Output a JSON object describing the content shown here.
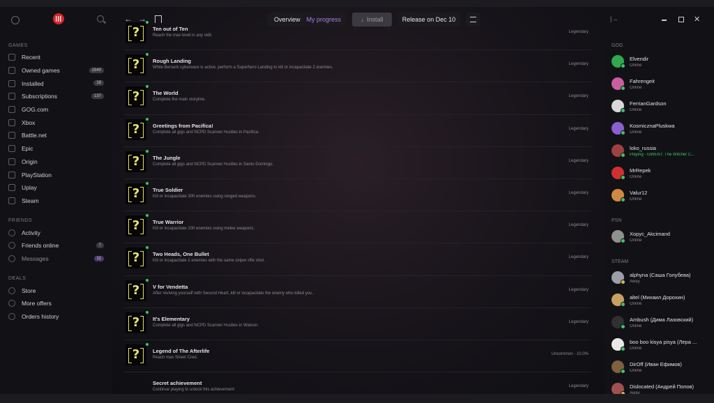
{
  "sidebar": {
    "games_header": "GAMES",
    "games": [
      {
        "label": "Recent",
        "badge": ""
      },
      {
        "label": "Owned games",
        "badge": "1540"
      },
      {
        "label": "Installed",
        "badge": "18"
      },
      {
        "label": "Subscriptions",
        "badge": "137"
      },
      {
        "label": "GOG.com",
        "badge": ""
      },
      {
        "label": "Xbox",
        "badge": ""
      },
      {
        "label": "Battle.net",
        "badge": ""
      },
      {
        "label": "Epic",
        "badge": ""
      },
      {
        "label": "Origin",
        "badge": ""
      },
      {
        "label": "PlayStation",
        "badge": ""
      },
      {
        "label": "Uplay",
        "badge": ""
      },
      {
        "label": "Steam",
        "badge": ""
      }
    ],
    "friends_header": "FRIENDS",
    "friends": [
      {
        "label": "Activity",
        "badge": ""
      },
      {
        "label": "Friends online",
        "badge": "7"
      },
      {
        "label": "Messages",
        "badge": "11"
      }
    ],
    "deals_header": "DEALS",
    "deals": [
      {
        "label": "Store"
      },
      {
        "label": "More offers"
      },
      {
        "label": "Orders history"
      }
    ]
  },
  "toolbar": {
    "tab_overview": "Overview",
    "tab_progress": "My progress",
    "install_label": "Install",
    "release_label": "Release on Dec 10"
  },
  "achievements": [
    {
      "title": "Ten out of Ten",
      "desc": "Reach the max level in any skill.",
      "rarity": "Legendary"
    },
    {
      "title": "Rough Landing",
      "desc": "While Berserk cyberware is active, perform a Superhero Landing to kill or incapacitate 2 enemies.",
      "rarity": "Legendary"
    },
    {
      "title": "The World",
      "desc": "Complete the main storyline.",
      "rarity": "Legendary"
    },
    {
      "title": "Greetings from Pacifica!",
      "desc": "Complete all gigs and NCPD Scanner Hustles in Pacifica.",
      "rarity": "Legendary"
    },
    {
      "title": "The Jungle",
      "desc": "Complete all gigs and NCPD Scanner Hustles in Santo Domingo.",
      "rarity": "Legendary"
    },
    {
      "title": "True Soldier",
      "desc": "Kill or incapacitate 300 enemies using ranged weapons.",
      "rarity": "Legendary"
    },
    {
      "title": "True Warrior",
      "desc": "Kill or incapacitate 100 enemies using melee weapons.",
      "rarity": "Legendary"
    },
    {
      "title": "Two Heads, One Bullet",
      "desc": "Kill or incapacitate 2 enemies with the same sniper rifle shot.",
      "rarity": "Legendary"
    },
    {
      "title": "V for Vendetta",
      "desc": "After reviving yourself with Second Heart, kill or incapacitate the enemy who killed you.",
      "rarity": "Legendary"
    },
    {
      "title": "It's Elementary",
      "desc": "Complete all gigs and NCPD Scanner Hustles in Watson.",
      "rarity": "Legendary"
    },
    {
      "title": "Legend of The Afterlife",
      "desc": "Reach max Street Cred.",
      "rarity": "Uncommon - 10.0%"
    },
    {
      "title": "Secret achievement",
      "desc": "Continue playing to unlock this achievement",
      "rarity": "Legendary"
    }
  ],
  "friends_panel": {
    "gog_header": "GOG",
    "gog": [
      {
        "name": "Elvendir",
        "status": "Online",
        "color": "#2fa84f"
      },
      {
        "name": "Fahrengeit",
        "status": "Online",
        "color": "#c85fa0"
      },
      {
        "name": "FerrianGardson",
        "status": "Online",
        "color": "#d8d8d8"
      },
      {
        "name": "KosmicznaPluskwa",
        "status": "Online",
        "color": "#8a5fd0"
      },
      {
        "name": "loko_russia",
        "status": "Playing - GWENT: The Witcher C...",
        "color": "#a04040"
      },
      {
        "name": "MrRepek",
        "status": "Online",
        "color": "#d03030"
      },
      {
        "name": "Valur12",
        "status": "Online",
        "color": "#d08a40"
      }
    ],
    "psn_header": "PSN",
    "psn": [
      {
        "name": "Xopyc_Akcimand",
        "status": "Online",
        "color": "#909090"
      }
    ],
    "steam_header": "STEAM",
    "steam": [
      {
        "name": "alphyna (Саша Голубева)",
        "status": "Away",
        "color": "#9aa0a8"
      },
      {
        "name": "altel (Михаил Дорохин)",
        "status": "Online",
        "color": "#c8a060"
      },
      {
        "name": "Ambush (Дима Лазовский)",
        "status": "Online",
        "color": "#303030"
      },
      {
        "name": "boo boo kisya pisya (Лера ...",
        "status": "Online",
        "color": "#e8e8e8"
      },
      {
        "name": "DirOff (Иван Ефимов)",
        "status": "Online",
        "color": "#806040"
      },
      {
        "name": "Dislocated (Андрей Попов)",
        "status": "Away",
        "color": "#a05050"
      }
    ]
  }
}
